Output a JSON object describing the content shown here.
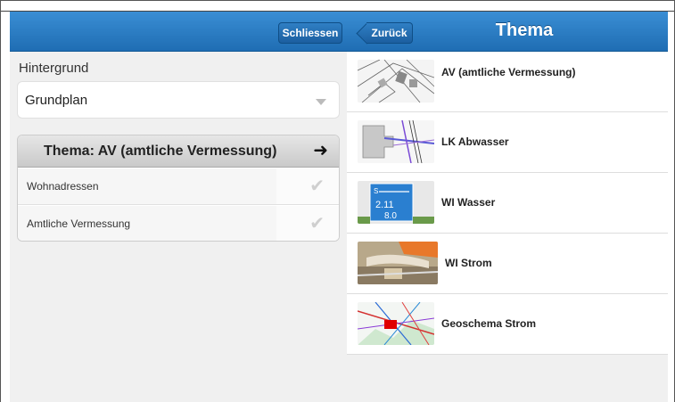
{
  "header": {
    "close_label": "Schliessen",
    "back_label": "Zurück",
    "title": "Thema"
  },
  "left": {
    "background_label": "Hintergrund",
    "background_select": {
      "selected": "Grundplan"
    },
    "theme_group": {
      "title": "Thema: AV (amtliche Vermessung)",
      "items": [
        {
          "label": "Wohnadressen",
          "icon": "checkmark-icon"
        },
        {
          "label": "Amtliche Vermessung",
          "icon": "checkmark-icon"
        }
      ]
    }
  },
  "themes": [
    {
      "label": "AV (amtliche Vermessung)",
      "icon": "cadastral-map-thumbnail"
    },
    {
      "label": "LK Abwasser",
      "icon": "wastewater-map-thumbnail"
    },
    {
      "label": "WI Wasser",
      "icon": "water-sign-thumbnail"
    },
    {
      "label": "WI Strom",
      "icon": "electricity-photo-thumbnail"
    },
    {
      "label": "Geoschema Strom",
      "icon": "power-network-map-thumbnail"
    }
  ],
  "colors": {
    "header_blue": "#1f6db3",
    "panel_bg": "#f0f0f0"
  }
}
